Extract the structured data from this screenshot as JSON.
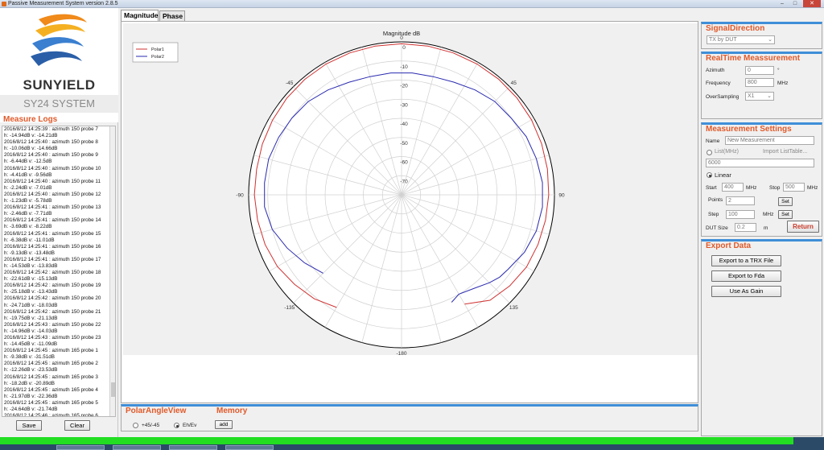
{
  "window": {
    "title": "Passive Measurement System  version 2.8.5",
    "controls": [
      "–",
      "□",
      "✕"
    ]
  },
  "brand": {
    "name": "SUNYIELD",
    "system": "SY24 SYSTEM"
  },
  "logs": {
    "title": "Measure Logs",
    "lines": [
      "2016/8/12 14:25:39 : azimuth 150  probe 7",
      "h: -14.94dB v: -14.21dB",
      "2016/8/12 14:25:40 : azimuth 150  probe 8",
      "h: -10.06dB v: -14.66dB",
      "2016/8/12 14:25:40 : azimuth 150  probe 9",
      "h: -6.44dB v: -12.5dB",
      "2016/8/12 14:25:40 : azimuth 150  probe 10",
      "h: -4.41dB v: -9.56dB",
      "2016/8/12 14:25:40 : azimuth 150  probe 11",
      "h: -2.24dB v: -7.01dB",
      "2016/8/12 14:25:40 : azimuth 150  probe 12",
      "h: -1.23dB v: -5.78dB",
      "2016/8/12 14:25:41 : azimuth 150  probe 13",
      "h: -2.46dB v: -7.71dB",
      "2016/8/12 14:25:41 : azimuth 150  probe 14",
      "h: -3.69dB v: -8.22dB",
      "2016/8/12 14:25:41 : azimuth 150  probe 15",
      "h: -6.38dB v: -11.01dB",
      "2016/8/12 14:25:41 : azimuth 150  probe 16",
      "h: -9.13dB v: -13.48dB",
      "2016/8/12 14:25:41 : azimuth 150  probe 17",
      "h: -14.53dB v: -13.83dB",
      "2016/8/12 14:25:42 : azimuth 150  probe 18",
      "h: -22.61dB v: -15.13dB",
      "2016/8/12 14:25:42 : azimuth 150  probe 19",
      "h: -25.18dB v: -13.43dB",
      "2016/8/12 14:25:42 : azimuth 150  probe 20",
      "h: -24.71dB v: -18.03dB",
      "2016/8/12 14:25:42 : azimuth 150  probe 21",
      "h: -19.75dB v: -21.13dB",
      "2016/8/12 14:25:43 : azimuth 150  probe 22",
      "h: -14.96dB v: -14.03dB",
      "2016/8/12 14:25:43 : azimuth 150  probe 23",
      "h: -14.45dB v: -11.09dB",
      "2016/8/12 14:25:45 : azimuth 165  probe 1",
      "h: -9.38dB v: -31.51dB",
      "2016/8/12 14:25:45 : azimuth 165  probe 2",
      "h: -12.26dB v: -23.53dB",
      "2016/8/12 14:25:45 : azimuth 165  probe 3",
      "h: -18.2dB v: -20.89dB",
      "2016/8/12 14:25:45 : azimuth 165  probe 4",
      "h: -21.97dB v: -22.36dB",
      "2016/8/12 14:25:45 : azimuth 165  probe 5",
      "h: -24.64dB v: -21.74dB",
      "2016/8/12 14:25:46 : azimuth 165  probe 6"
    ],
    "save_label": "Save",
    "clear_label": "Clear"
  },
  "tabs": [
    {
      "label": "Magnitude",
      "active": true
    },
    {
      "label": "Phase",
      "active": false
    }
  ],
  "chart_data": {
    "type": "line",
    "title": "Magnitude dB",
    "radial_ticks": [
      "0",
      "-10",
      "-20",
      "-30",
      "-40",
      "-50",
      "-60",
      "-70"
    ],
    "radial_range": [
      -80,
      0
    ],
    "angle_labels": [
      {
        "angle": 0,
        "label": "0"
      },
      {
        "angle": 45,
        "label": "45"
      },
      {
        "angle": 90,
        "label": "90"
      },
      {
        "angle": 135,
        "label": "135"
      },
      {
        "angle": 180,
        "label": "-180"
      },
      {
        "angle": -135,
        "label": "-135"
      },
      {
        "angle": -90,
        "label": "-90"
      },
      {
        "angle": -45,
        "label": "-45"
      }
    ],
    "grid": true,
    "legend_position": "top-left",
    "series": [
      {
        "name": "Polar1",
        "color": "#d03030",
        "points": [
          [
            -150,
            -12
          ],
          [
            -140,
            -9
          ],
          [
            -130,
            -7
          ],
          [
            -120,
            -5
          ],
          [
            -110,
            -4
          ],
          [
            -100,
            -3.5
          ],
          [
            -90,
            -3
          ],
          [
            -80,
            -3
          ],
          [
            -70,
            -2.5
          ],
          [
            -60,
            -2
          ],
          [
            -50,
            -1.5
          ],
          [
            -40,
            -1.2
          ],
          [
            -30,
            -1
          ],
          [
            -20,
            -1
          ],
          [
            -10,
            -1
          ],
          [
            0,
            -1
          ],
          [
            10,
            -1
          ],
          [
            20,
            -1
          ],
          [
            30,
            -1
          ],
          [
            40,
            -1
          ],
          [
            50,
            -1.2
          ],
          [
            60,
            -1.5
          ],
          [
            70,
            -2
          ],
          [
            80,
            -2.5
          ],
          [
            90,
            -3
          ],
          [
            100,
            -3.5
          ],
          [
            110,
            -4
          ],
          [
            120,
            -4.5
          ],
          [
            130,
            -6
          ],
          [
            140,
            -8
          ],
          [
            150,
            -14
          ]
        ]
      },
      {
        "name": "Polar2",
        "color": "#2a2ab0",
        "points": [
          [
            -135,
            -22
          ],
          [
            -125,
            -18
          ],
          [
            -115,
            -14
          ],
          [
            -105,
            -10
          ],
          [
            -95,
            -8
          ],
          [
            -85,
            -8
          ],
          [
            -75,
            -8
          ],
          [
            -65,
            -9
          ],
          [
            -55,
            -10
          ],
          [
            -45,
            -11
          ],
          [
            -35,
            -13
          ],
          [
            -25,
            -15
          ],
          [
            -15,
            -16
          ],
          [
            -5,
            -16
          ],
          [
            5,
            -16
          ],
          [
            15,
            -16
          ],
          [
            25,
            -15
          ],
          [
            35,
            -13
          ],
          [
            45,
            -11
          ],
          [
            55,
            -10
          ],
          [
            65,
            -8
          ],
          [
            75,
            -7
          ],
          [
            85,
            -6
          ],
          [
            95,
            -6
          ],
          [
            105,
            -7
          ],
          [
            115,
            -9
          ],
          [
            125,
            -12
          ],
          [
            130,
            -13
          ],
          [
            135,
            -15
          ],
          [
            142,
            -18
          ],
          [
            150,
            -20
          ],
          [
            155,
            -18
          ]
        ]
      }
    ]
  },
  "polar_view": {
    "title": "PolarAngleView",
    "opt1": "+45/-45",
    "opt2": "Eh/Ev",
    "selected": "Eh/Ev"
  },
  "memory": {
    "title": "Memory",
    "add_label": "add"
  },
  "signal": {
    "title": "SignalDirection",
    "value": "TX by DUT"
  },
  "realtime": {
    "title": "RealTime Meassurement",
    "azimuth_label": "Azimuth",
    "azimuth_value": "0",
    "azimuth_unit": "°",
    "freq_label": "Frequency",
    "freq_value": "800",
    "freq_unit": "MHz",
    "os_label": "OverSampling",
    "os_value": "X1"
  },
  "settings": {
    "title": "Measurement Settings",
    "name_label": "Name",
    "name_value": "New Measurement",
    "list_label": "List(MHz)",
    "import_label": "Import ListTable...",
    "list_value": "6000",
    "linear_label": "Linear",
    "start_label": "Start",
    "start_value": "400",
    "start_unit": "MHz",
    "stop_label": "Stop",
    "stop_value": "500",
    "stop_unit": "MHz",
    "points_label": "Points",
    "points_value": "2",
    "set1_label": "Set",
    "step_label": "Step",
    "step_value": "100",
    "step_unit": "MHz",
    "set2_label": "Set",
    "dut_label": "DUT Size",
    "dut_value": "0.2",
    "dut_unit": "m",
    "return_label": "Return"
  },
  "export": {
    "title": "Export Data",
    "trx_label": "Export to a TRX File",
    "fda_label": "Export to Fda",
    "gain_label": "Use As Gain"
  }
}
